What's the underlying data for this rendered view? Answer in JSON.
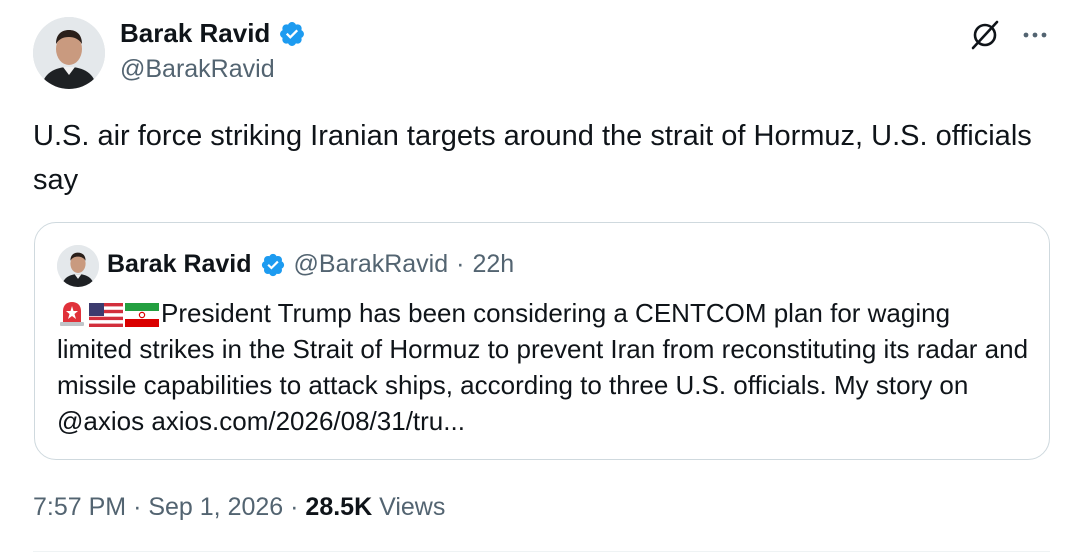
{
  "tweet": {
    "author_name": "Barak Ravid",
    "author_handle": "@BarakRavid",
    "text": "U.S. air force striking Iranian targets around the strait of Hormuz, U.S. officials say",
    "time": "7:57 PM",
    "date": "Sep 1, 2026",
    "views_count": "28.5K",
    "views_label": "Views",
    "meta_separator": "·"
  },
  "quoted_tweet": {
    "author_name": "Barak Ravid",
    "author_handle": "@BarakRavid",
    "separator": "·",
    "time_ago": "22h",
    "emojis": [
      "siren-icon",
      "us-flag-icon",
      "iran-flag-icon"
    ],
    "text": "President Trump has been considering a CENTCOM plan for waging limited strikes in the Strait of Hormuz to prevent Iran from reconstituting its radar and missile capabilities to attack ships, according to three U.S. officials. My story on @axios axios.com/2026/08/31/tru..."
  },
  "icons": {
    "verified": "verified-badge-icon",
    "grok": "grok-icon",
    "more": "more-options-icon"
  },
  "colors": {
    "verified_blue": "#1d9bf0",
    "secondary_text": "#536471",
    "primary_text": "#0f1419",
    "border": "#cfd9de"
  }
}
